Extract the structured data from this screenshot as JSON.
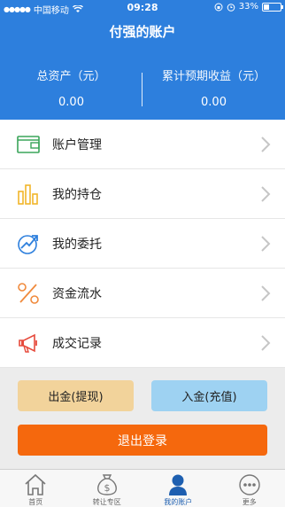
{
  "status_bar": {
    "carrier": "中国移动",
    "time": "09:28",
    "battery": "33%"
  },
  "header": {
    "title": "付强的账户",
    "total_assets_label": "总资产（元）",
    "total_assets_value": "0.00",
    "expected_income_label": "累计预期收益（元）",
    "expected_income_value": "0.00"
  },
  "menu": {
    "items": [
      {
        "label": "账户管理",
        "icon": "wallet-icon"
      },
      {
        "label": "我的持仓",
        "icon": "bar-chart-icon"
      },
      {
        "label": "我的委托",
        "icon": "trend-arrow-icon"
      },
      {
        "label": "资金流水",
        "icon": "percent-icon"
      },
      {
        "label": "成交记录",
        "icon": "megaphone-icon"
      }
    ]
  },
  "actions": {
    "withdraw": "出金(提现)",
    "deposit": "入金(充值)",
    "logout": "退出登录"
  },
  "tabbar": {
    "items": [
      {
        "label": "首页",
        "icon": "home-icon"
      },
      {
        "label": "转让专区",
        "icon": "money-bag-icon"
      },
      {
        "label": "我的账户",
        "icon": "user-icon",
        "active": true
      },
      {
        "label": "更多",
        "icon": "more-icon"
      }
    ]
  },
  "colors": {
    "header_bg": "#2d7fdd",
    "withdraw_bg": "#f2d39b",
    "deposit_bg": "#9ed2f2",
    "logout_bg": "#f5680d",
    "active_tab": "#1e5fb0"
  }
}
